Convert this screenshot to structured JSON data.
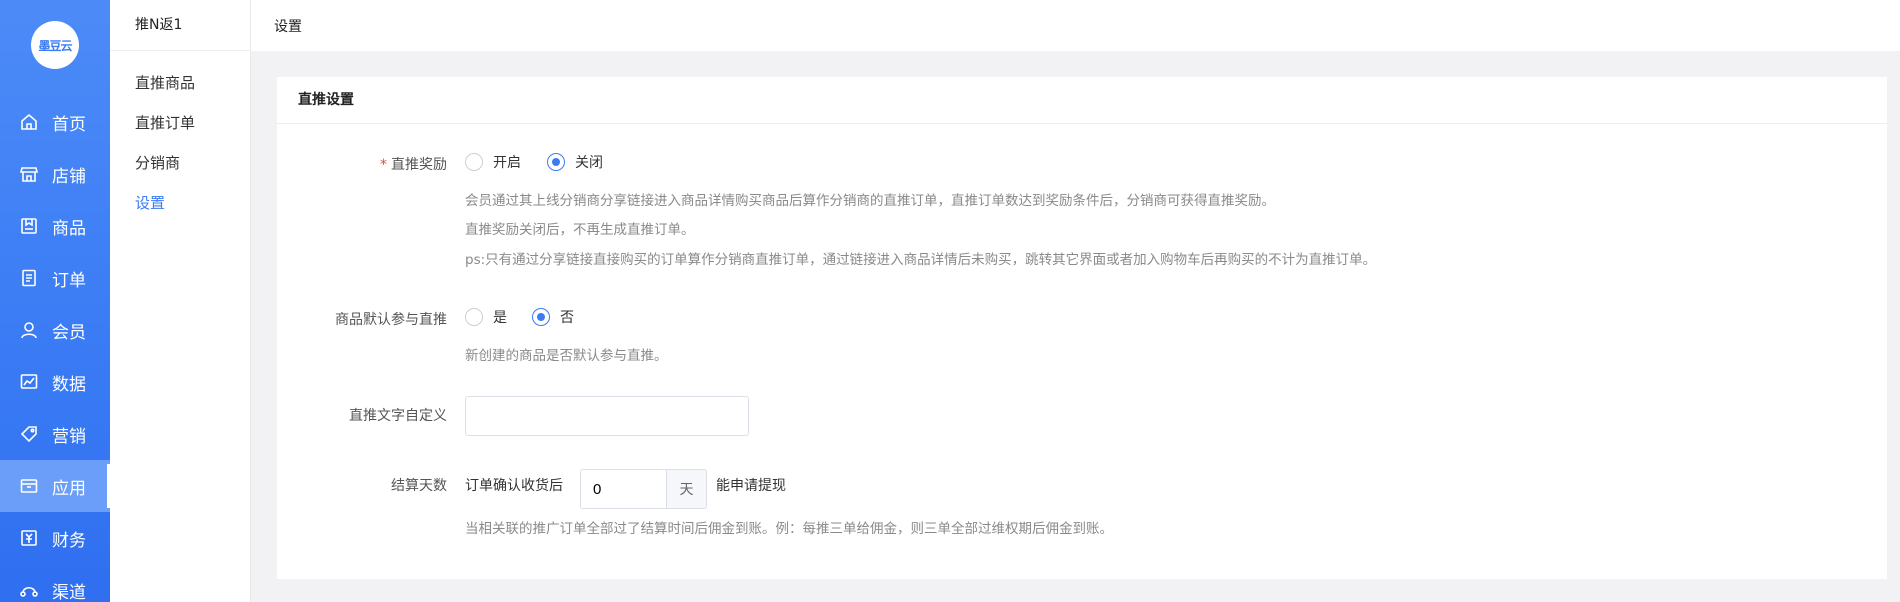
{
  "logo": {
    "text": "墨豆云"
  },
  "nav": [
    {
      "label": "首页",
      "icon": "home-icon"
    },
    {
      "label": "店铺",
      "icon": "store-icon"
    },
    {
      "label": "商品",
      "icon": "goods-icon"
    },
    {
      "label": "订单",
      "icon": "order-icon"
    },
    {
      "label": "会员",
      "icon": "member-icon"
    },
    {
      "label": "数据",
      "icon": "chart-icon"
    },
    {
      "label": "营销",
      "icon": "tag-icon"
    },
    {
      "label": "应用",
      "icon": "app-icon",
      "active": true
    },
    {
      "label": "财务",
      "icon": "finance-icon"
    },
    {
      "label": "渠道",
      "icon": "channel-icon"
    }
  ],
  "subnav": {
    "title": "推N返1",
    "items": [
      {
        "label": "直推商品"
      },
      {
        "label": "直推订单"
      },
      {
        "label": "分销商"
      },
      {
        "label": "设置",
        "active": true
      }
    ]
  },
  "header": {
    "title": "设置"
  },
  "card": {
    "title": "直推设置",
    "reward": {
      "label": "直推奖励",
      "options": [
        "开启",
        "关闭"
      ],
      "selected": "关闭",
      "hints": [
        "会员通过其上线分销商分享链接进入商品详情购买商品后算作分销商的直推订单，直推订单数达到奖励条件后，分销商可获得直推奖励。",
        "直推奖励关闭后，不再生成直推订单。",
        "ps:只有通过分享链接直接购买的订单算作分销商直推订单，通过链接进入商品详情后未购买，跳转其它界面或者加入购物车后再购买的不计为直推订单。"
      ]
    },
    "default_join": {
      "label": "商品默认参与直推",
      "options": [
        "是",
        "否"
      ],
      "selected": "否",
      "hint": "新创建的商品是否默认参与直推。"
    },
    "custom_text": {
      "label": "直推文字自定义",
      "value": ""
    },
    "settle": {
      "label": "结算天数",
      "prefix": "订单确认收货后",
      "value": "0",
      "unit": "天",
      "suffix": "能申请提现",
      "hint": "当相关联的推广订单全部过了结算时间后佣金到账。例：每推三单给佣金，则三单全部过维权期后佣金到账。"
    }
  },
  "colors": {
    "primary": "#3b7cf5",
    "required": "#e54545"
  }
}
